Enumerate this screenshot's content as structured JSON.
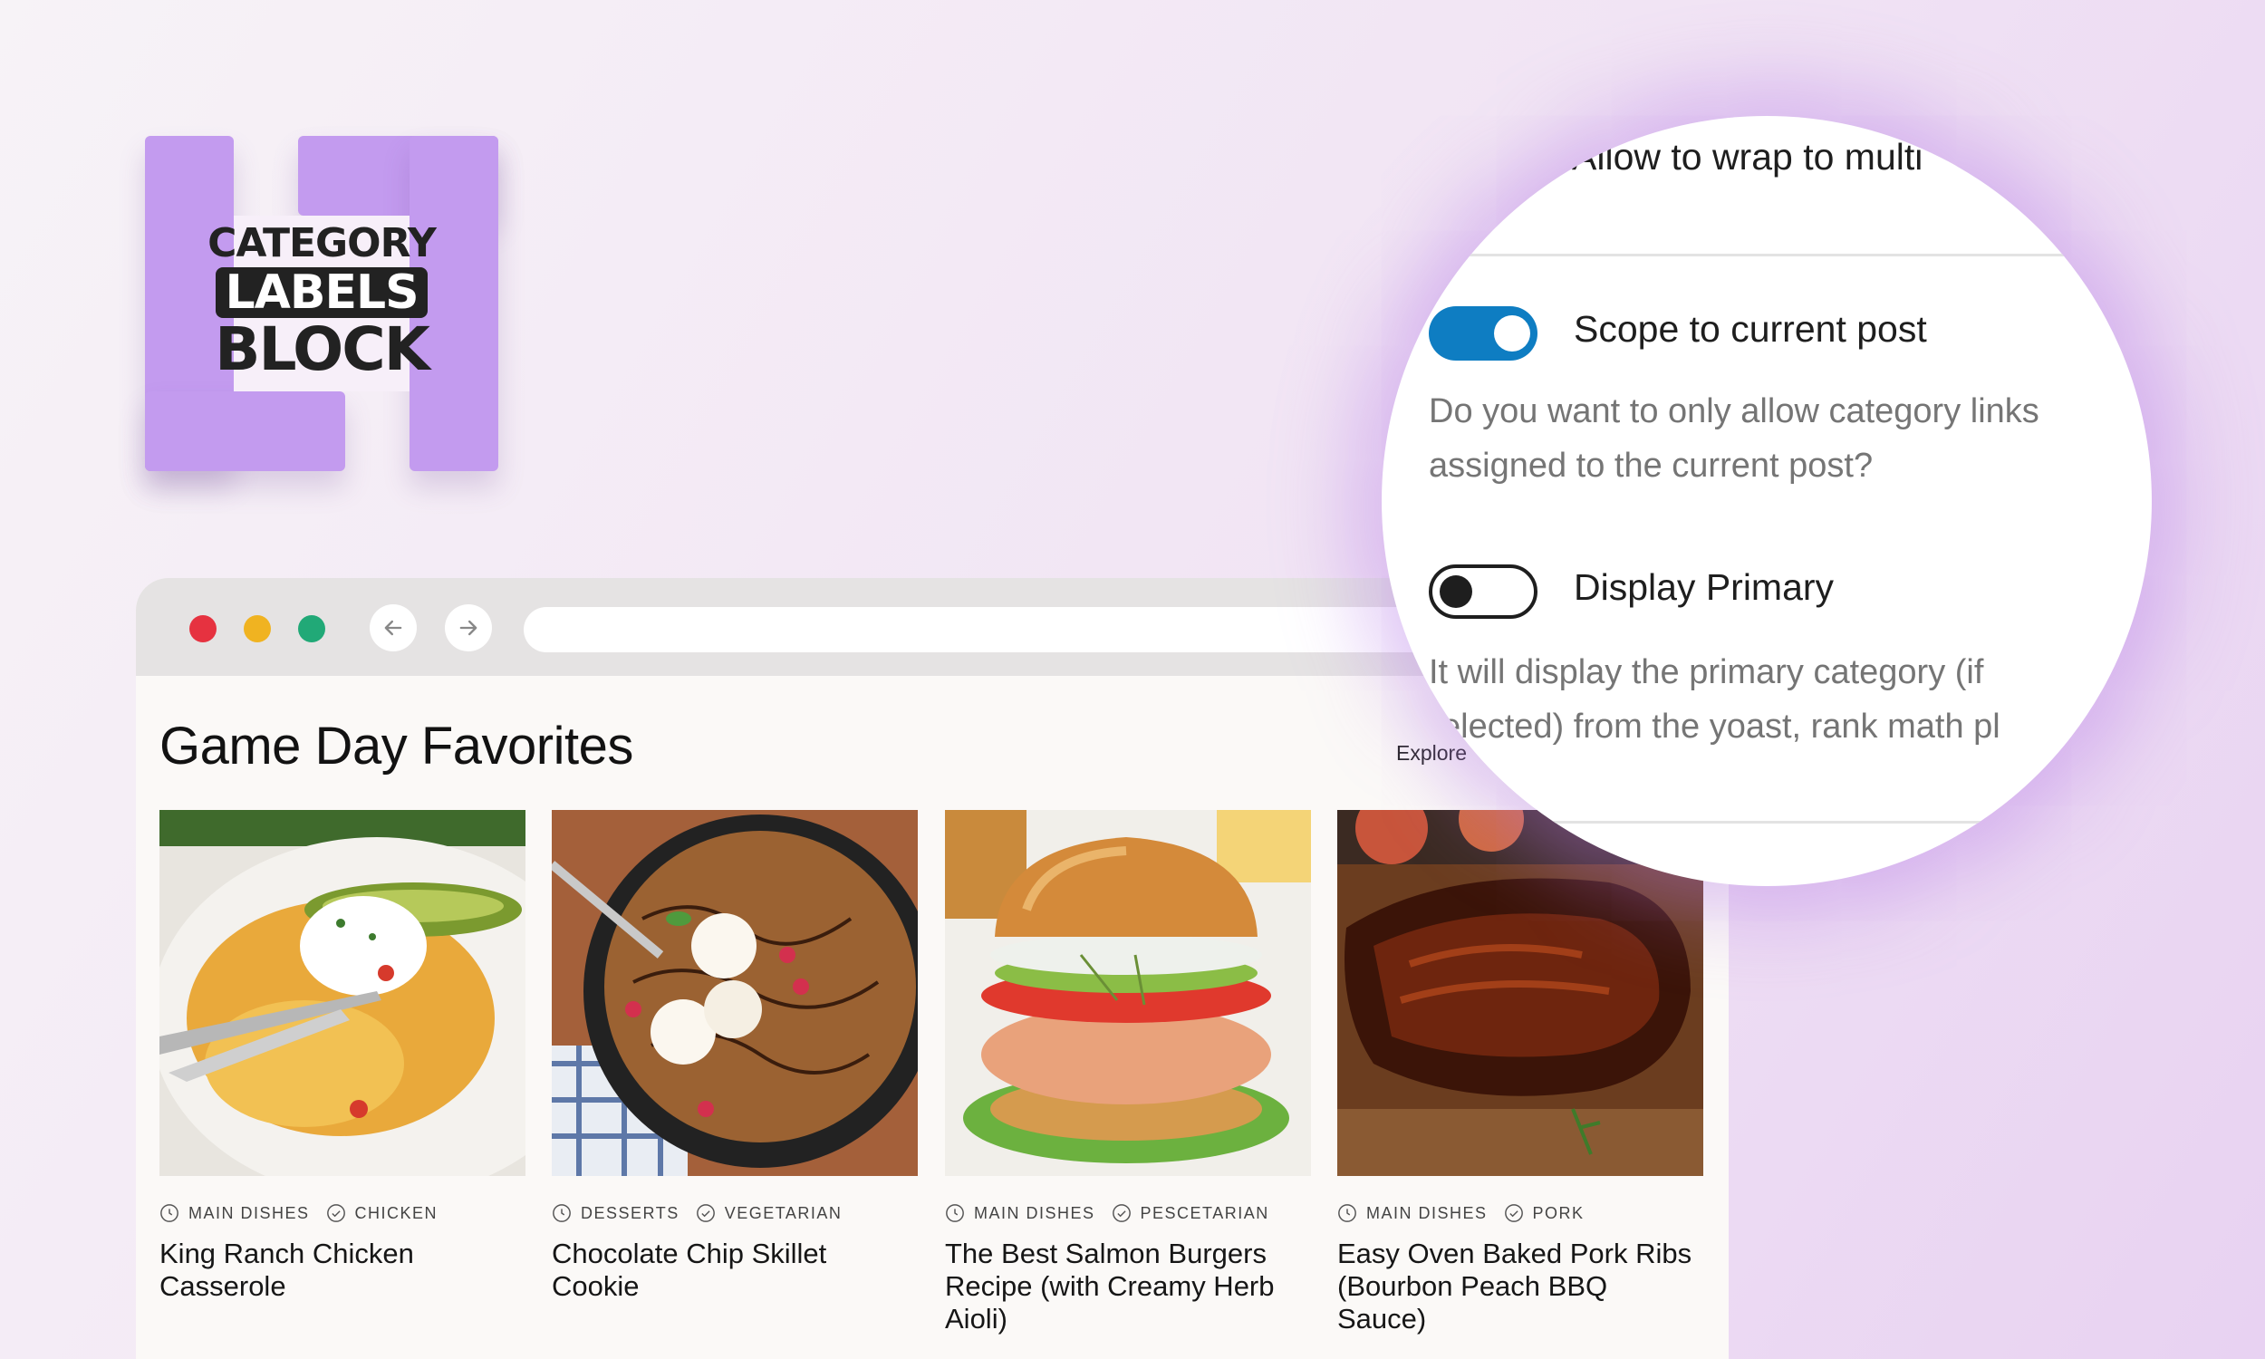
{
  "logo": {
    "line1": "CATEGORY",
    "line2": "LABELS",
    "line3": "BLOCK",
    "accent": "#c39bef"
  },
  "browser": {
    "window_dots": [
      "#e63240",
      "#f0b321",
      "#21a977"
    ],
    "back_icon": "arrow-left-icon",
    "forward_icon": "arrow-right-icon",
    "section_title": "Game Day Favorites",
    "explore_label": "Explore",
    "cards": [
      {
        "cat1": "MAIN DISHES",
        "cat2": "CHICKEN",
        "title": "King Ranch Chicken Casserole"
      },
      {
        "cat1": "DESSERTS",
        "cat2": "VEGETARIAN",
        "title": "Chocolate Chip Skillet Cookie"
      },
      {
        "cat1": "MAIN DISHES",
        "cat2": "PESCETARIAN",
        "title": "The Best Salmon Burgers Recipe (with Creamy Herb Aioli)"
      },
      {
        "cat1": "MAIN DISHES",
        "cat2": "PORK",
        "title": "Easy Oven Baked Pork Ribs (Bourbon Peach BBQ Sauce)"
      }
    ]
  },
  "zoom": {
    "top_option": "Allow to wrap to multi",
    "scope": {
      "label": "Scope to current post",
      "enabled": true,
      "help_line1": "Do you want to only allow category links",
      "help_line2": "assigned to the current post?"
    },
    "primary": {
      "label": "Display Primary",
      "enabled": false,
      "help_line1": "It will display the primary category (if",
      "help_line2": "elected) from the yoast, rank math pl"
    },
    "toggle_on_color": "#0e7dc2"
  }
}
